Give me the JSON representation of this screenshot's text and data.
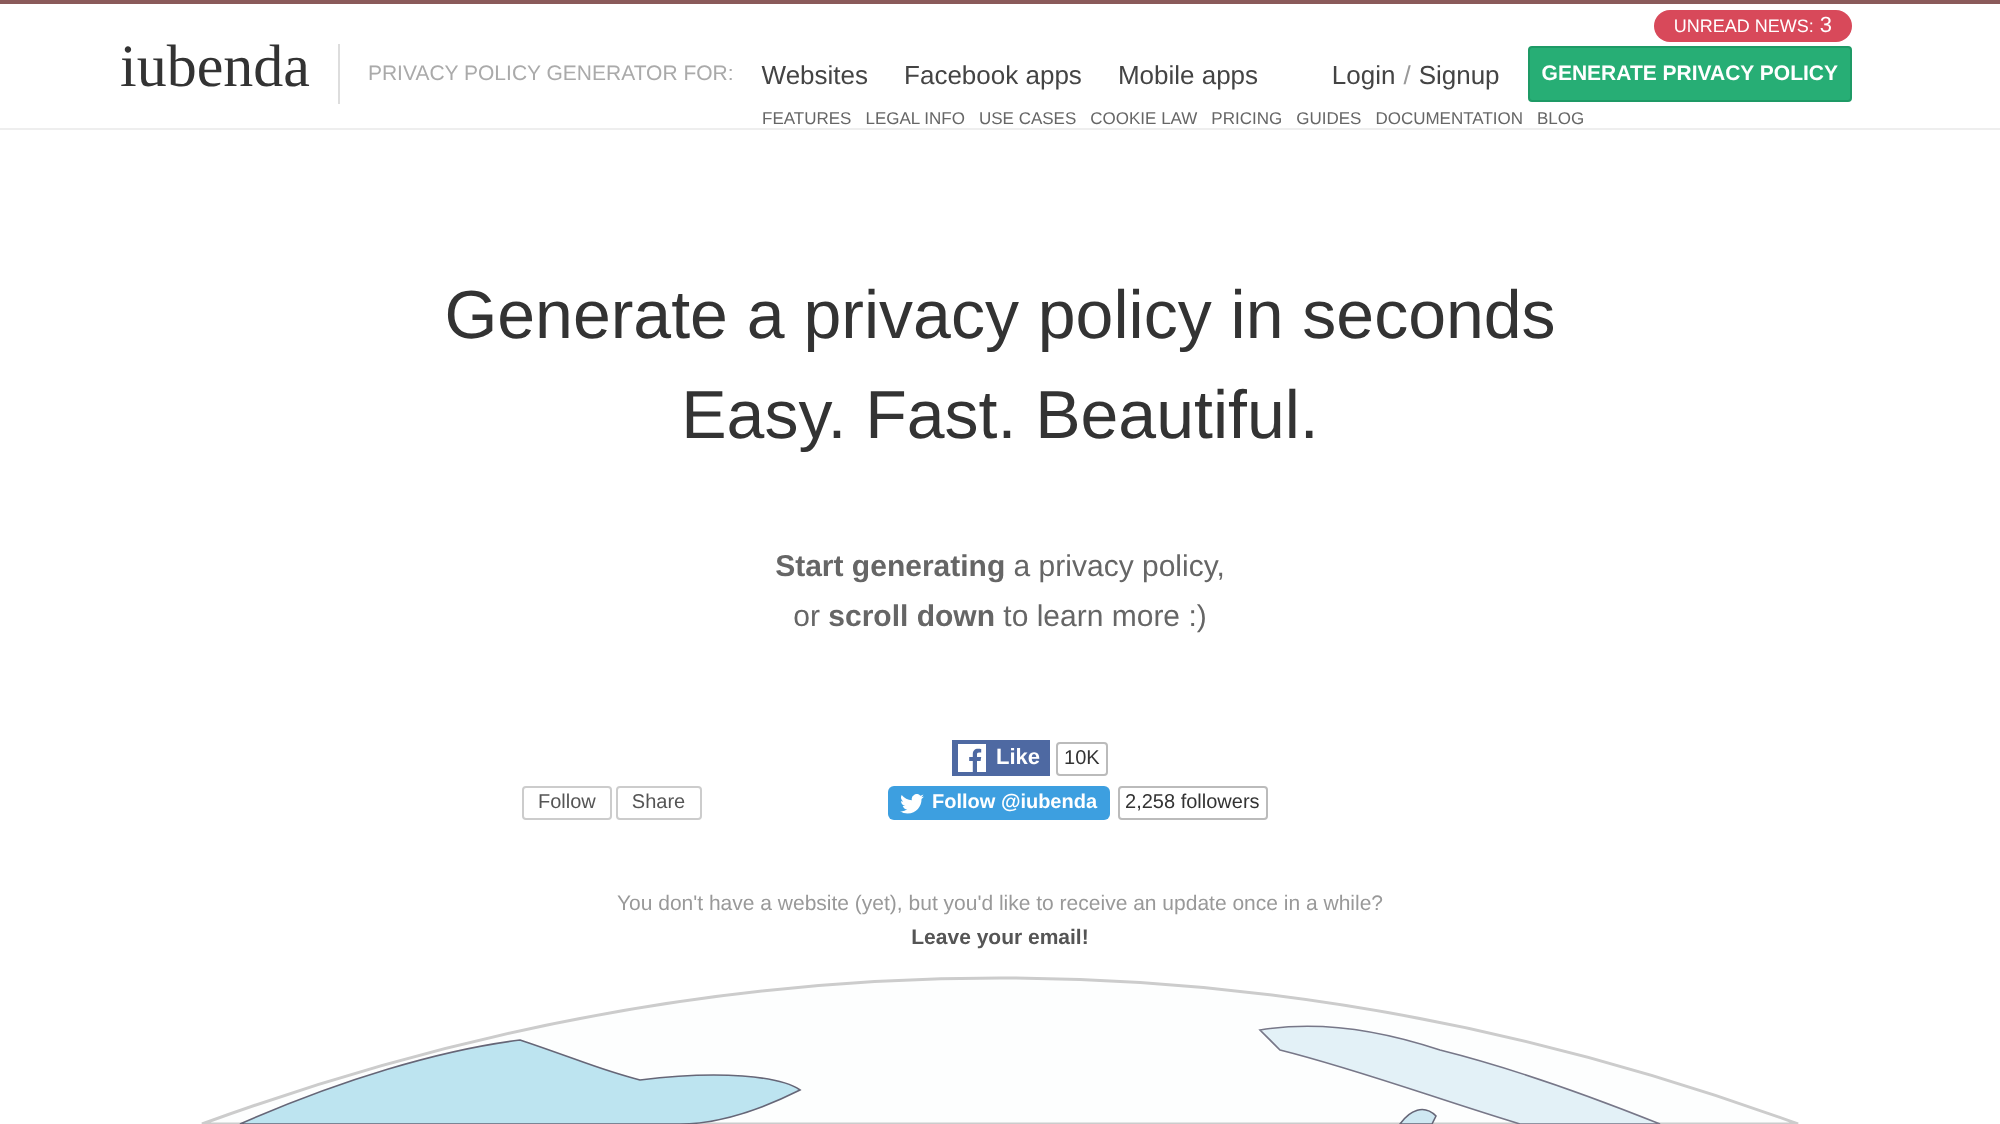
{
  "header": {
    "logo": "iubenda",
    "badge": {
      "label": "UNREAD NEWS:",
      "count": "3"
    },
    "generator_label": "PRIVACY POLICY GENERATOR FOR:",
    "links": [
      "Websites",
      "Facebook apps",
      "Mobile apps"
    ],
    "login": "Login",
    "separator": "/",
    "signup": "Signup",
    "cta": "GENERATE PRIVACY POLICY",
    "sub_links": [
      "FEATURES",
      "LEGAL INFO",
      "USE CASES",
      "COOKIE LAW",
      "PRICING",
      "GUIDES",
      "DOCUMENTATION",
      "BLOG"
    ]
  },
  "hero": {
    "headline": [
      "Generate a privacy policy in seconds",
      "Easy. Fast. Beautiful."
    ],
    "intro": [
      "**Start generating** a privacy policy,",
      "or **scroll down** to learn more :)"
    ]
  },
  "social": {
    "follow": "Follow",
    "share": "Share",
    "like": "Like",
    "like_count": "10K",
    "twitter": "Follow @iubenda",
    "followers": "2,258 followers"
  },
  "newsletter": {
    "text": "You don't have a website (yet), but you'd like to receive an update once in a while?",
    "link": "Leave your email!"
  }
}
